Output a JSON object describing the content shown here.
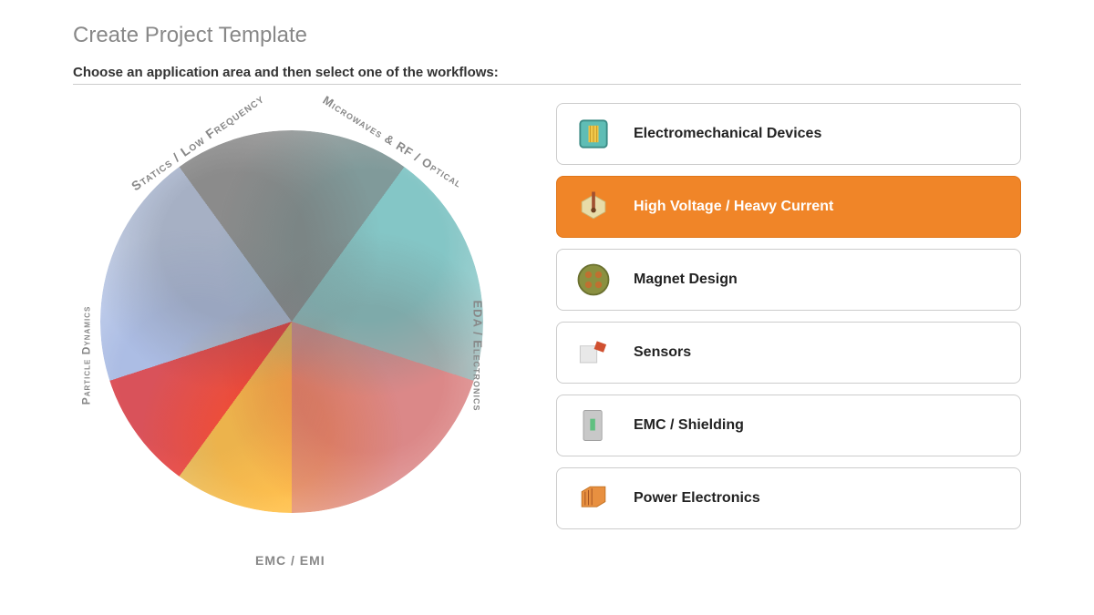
{
  "header": {
    "title": "Create Project Template",
    "subtitle": "Choose an application area and then select one of the workflows:"
  },
  "wheel": {
    "labels": {
      "statics": "Statics / Low Frequency",
      "microwaves": "Microwaves & RF / Optical",
      "eda": "EDA / Electronics",
      "emc": "EMC / EMI",
      "particle": "Particle Dynamics"
    }
  },
  "workflows": [
    {
      "label": "Electromechanical Devices",
      "selected": false,
      "icon": "device-icon"
    },
    {
      "label": "High Voltage / Heavy Current",
      "selected": true,
      "icon": "high-voltage-icon"
    },
    {
      "label": "Magnet Design",
      "selected": false,
      "icon": "magnet-icon"
    },
    {
      "label": "Sensors",
      "selected": false,
      "icon": "sensor-icon"
    },
    {
      "label": "EMC / Shielding",
      "selected": false,
      "icon": "shielding-icon"
    },
    {
      "label": "Power Electronics",
      "selected": false,
      "icon": "power-electronics-icon"
    }
  ],
  "colors": {
    "accent": "#f08528",
    "muted_text": "#888"
  }
}
